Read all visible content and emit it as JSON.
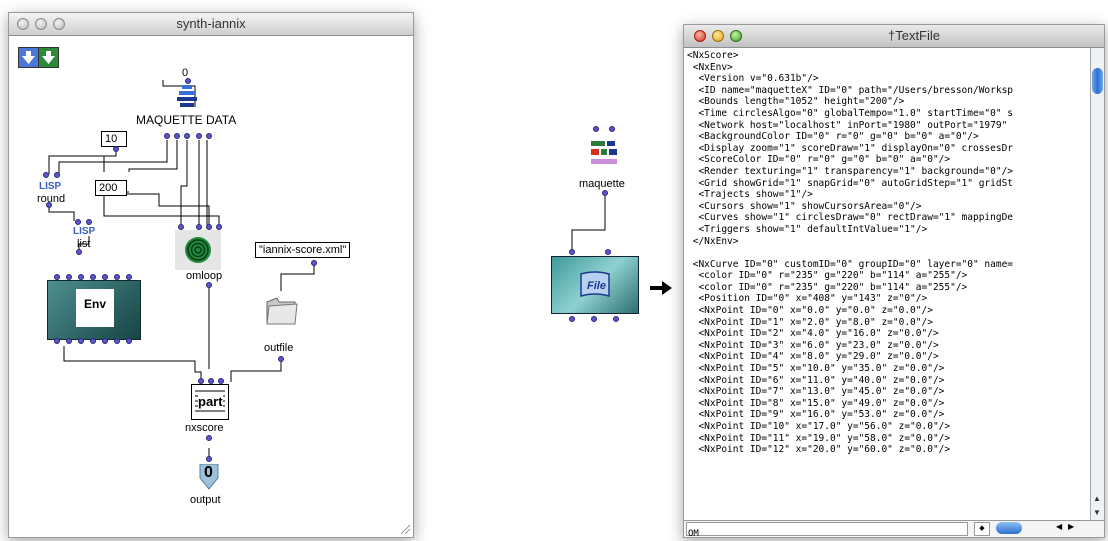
{
  "patch_window": {
    "title": "synth-iannix",
    "boxes": {
      "maquette_label": "MAQUETTE DATA",
      "maquette_top": "0",
      "num_10": "10",
      "round": "round",
      "num_200": "200",
      "list": "list",
      "omloop": "omloop",
      "string_value": "\"iannix-score.xml\"",
      "env": "Env",
      "outfile": "outfile",
      "part": "part",
      "nxscore": "nxscore",
      "output_value": "0",
      "output": "output",
      "lisp": "LISP"
    }
  },
  "middle": {
    "maquette_label": "maquette",
    "file_icon_text": "File"
  },
  "text_window": {
    "title": "†TextFile",
    "lines": [
      "<NxScore>",
      " <NxEnv>",
      "  <Version v=\"0.631b\"/>",
      "  <ID name=\"maquetteX\" ID=\"0\" path=\"/Users/bresson/Worksp",
      "  <Bounds length=\"1052\" height=\"200\"/>",
      "  <Time circlesAlgo=\"0\" globalTempo=\"1.0\" startTime=\"0\" s",
      "  <Network host=\"localhost\" inPort=\"1980\" outPort=\"1979\"",
      "  <BackgroundColor ID=\"0\" r=\"0\" g=\"0\" b=\"0\" a=\"0\"/>",
      "  <Display zoom=\"1\" scoreDraw=\"1\" displayOn=\"0\" crossesDr",
      "  <ScoreColor ID=\"0\" r=\"0\" g=\"0\" b=\"0\" a=\"0\"/>",
      "  <Render texturing=\"1\" transparency=\"1\" background=\"0\"/>",
      "  <Grid showGrid=\"1\" snapGrid=\"0\" autoGridStep=\"1\" gridSt",
      "  <Trajects show=\"1\"/>",
      "  <Cursors show=\"1\" showCursorsArea=\"0\"/>",
      "  <Curves show=\"1\" circlesDraw=\"0\" rectDraw=\"1\" mappingDe",
      "  <Triggers show=\"1\" defaultIntValue=\"1\"/>",
      " </NxEnv>",
      "",
      " <NxCurve ID=\"0\" customID=\"0\" groupID=\"0\" layer=\"0\" name=",
      "  <color ID=\"0\" r=\"235\" g=\"220\" b=\"114\" a=\"255\"/>",
      "  <color ID=\"0\" r=\"235\" g=\"220\" b=\"114\" a=\"255\"/>",
      "  <Position ID=\"0\" x=\"408\" y=\"143\" z=\"0\"/>",
      "  <NxPoint ID=\"0\" x=\"0.0\" y=\"0.0\" z=\"0.0\"/>",
      "  <NxPoint ID=\"1\" x=\"2.0\" y=\"8.0\" z=\"0.0\"/>",
      "  <NxPoint ID=\"2\" x=\"4.0\" y=\"16.0\" z=\"0.0\"/>",
      "  <NxPoint ID=\"3\" x=\"6.0\" y=\"23.0\" z=\"0.0\"/>",
      "  <NxPoint ID=\"4\" x=\"8.0\" y=\"29.0\" z=\"0.0\"/>",
      "  <NxPoint ID=\"5\" x=\"10.0\" y=\"35.0\" z=\"0.0\"/>",
      "  <NxPoint ID=\"6\" x=\"11.0\" y=\"40.0\" z=\"0.0\"/>",
      "  <NxPoint ID=\"7\" x=\"13.0\" y=\"45.0\" z=\"0.0\"/>",
      "  <NxPoint ID=\"8\" x=\"15.0\" y=\"49.0\" z=\"0.0\"/>",
      "  <NxPoint ID=\"9\" x=\"16.0\" y=\"53.0\" z=\"0.0\"/>",
      "  <NxPoint ID=\"10\" x=\"17.0\" y=\"56.0\" z=\"0.0\"/>",
      "  <NxPoint ID=\"11\" x=\"19.0\" y=\"58.0\" z=\"0.0\"/>",
      "  <NxPoint ID=\"12\" x=\"20.0\" y=\"60.0\" z=\"0.0\"/>"
    ],
    "status_text": "OM"
  },
  "colors": {
    "inlet": "#5b56c9",
    "env_box": "#2f6f6f",
    "file_box": "#3f9a9a"
  }
}
